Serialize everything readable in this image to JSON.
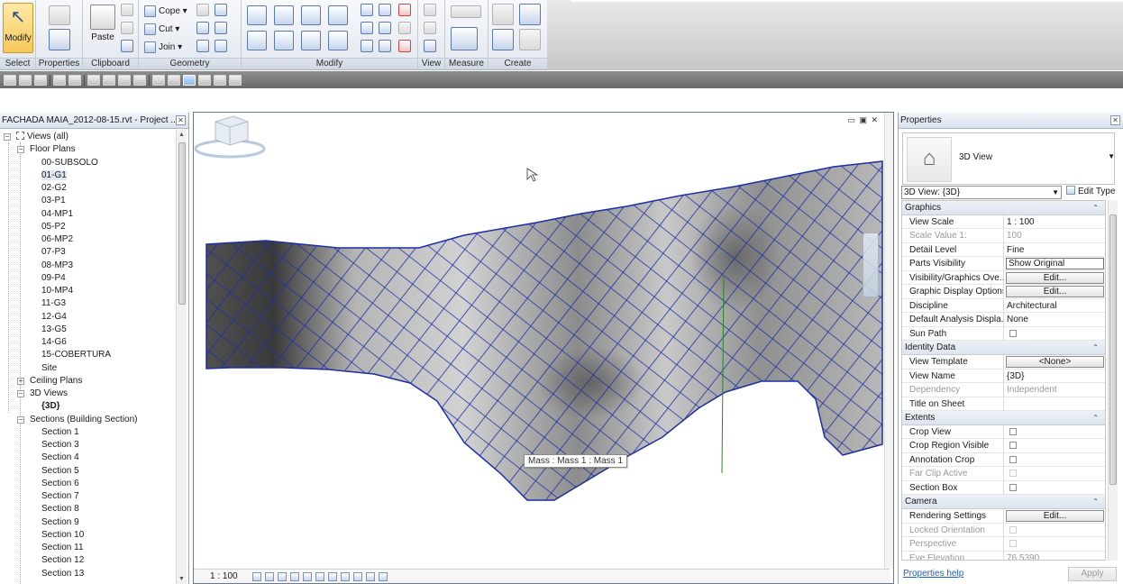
{
  "ribbon": {
    "modify_label": "Modify",
    "panels": {
      "select": "Select",
      "properties": "Properties",
      "clipboard": "Clipboard",
      "geometry": "Geometry",
      "modify": "Modify",
      "view": "View",
      "measure": "Measure",
      "create": "Create"
    },
    "paste_label": "Paste",
    "cope_label": "Cope",
    "cut_label": "Cut",
    "join_label": "Join"
  },
  "browser": {
    "title": "FACHADA MAIA_2012-08-15.rvt - Project ...",
    "items": [
      {
        "label": "Views (all)"
      },
      {
        "label": "Floor Plans"
      },
      {
        "label": "00-SUBSOLO"
      },
      {
        "label": "01-G1"
      },
      {
        "label": "02-G2"
      },
      {
        "label": "03-P1"
      },
      {
        "label": "04-MP1"
      },
      {
        "label": "05-P2"
      },
      {
        "label": "06-MP2"
      },
      {
        "label": "07-P3"
      },
      {
        "label": "08-MP3"
      },
      {
        "label": "09-P4"
      },
      {
        "label": "10-MP4"
      },
      {
        "label": "11-G3"
      },
      {
        "label": "12-G4"
      },
      {
        "label": "13-G5"
      },
      {
        "label": "14-G6"
      },
      {
        "label": "15-COBERTURA"
      },
      {
        "label": "Site"
      },
      {
        "label": "Ceiling Plans"
      },
      {
        "label": "3D Views"
      },
      {
        "label": "{3D}"
      },
      {
        "label": "Sections (Building Section)"
      },
      {
        "label": "Section 1"
      },
      {
        "label": "Section 3"
      },
      {
        "label": "Section 4"
      },
      {
        "label": "Section 5"
      },
      {
        "label": "Section 6"
      },
      {
        "label": "Section 7"
      },
      {
        "label": "Section 8"
      },
      {
        "label": "Section 9"
      },
      {
        "label": "Section 10"
      },
      {
        "label": "Section 11"
      },
      {
        "label": "Section 12"
      },
      {
        "label": "Section 13"
      }
    ],
    "toggle_minus": "−",
    "toggle_plus": "+"
  },
  "canvas": {
    "scale": "1 : 100",
    "tooltip": "Mass : Mass 1 : Mass 1",
    "window_controls": "▭ ▣ ✕"
  },
  "properties": {
    "title": "Properties",
    "type_name": "3D View",
    "instance_selector": "3D View: {3D}",
    "edit_type": "Edit Type",
    "rows": [
      {
        "label": "Graphics"
      },
      {
        "label": "View Scale",
        "value": "1 : 100"
      },
      {
        "label": "Scale Value    1:",
        "value": "100"
      },
      {
        "label": "Detail Level",
        "value": "Fine"
      },
      {
        "label": "Parts Visibility",
        "value": "Show Original"
      },
      {
        "label": "Visibility/Graphics Ove...",
        "value": "Edit..."
      },
      {
        "label": "Graphic Display Options",
        "value": "Edit..."
      },
      {
        "label": "Discipline",
        "value": "Architectural"
      },
      {
        "label": "Default Analysis Displa...",
        "value": "None"
      },
      {
        "label": "Sun Path",
        "value": ""
      },
      {
        "label": "Identity Data"
      },
      {
        "label": "View Template",
        "value": "<None>"
      },
      {
        "label": "View Name",
        "value": "{3D}"
      },
      {
        "label": "Dependency",
        "value": "Independent"
      },
      {
        "label": "Title on Sheet",
        "value": ""
      },
      {
        "label": "Extents"
      },
      {
        "label": "Crop View",
        "value": ""
      },
      {
        "label": "Crop Region Visible",
        "value": ""
      },
      {
        "label": "Annotation Crop",
        "value": ""
      },
      {
        "label": "Far Clip Active",
        "value": ""
      },
      {
        "label": "Section Box",
        "value": ""
      },
      {
        "label": "Camera"
      },
      {
        "label": "Rendering Settings",
        "value": "Edit..."
      },
      {
        "label": "Locked Orientation",
        "value": ""
      },
      {
        "label": "Perspective",
        "value": ""
      },
      {
        "label": "Eye Elevation",
        "value": "76.5390"
      }
    ],
    "help_link": "Properties help",
    "apply": "Apply",
    "collapse_glyph": "⌃"
  },
  "colors": {
    "grid": "#1d2fa3",
    "ribbon_active": "#f7c85b",
    "link": "#1f5fb4"
  }
}
